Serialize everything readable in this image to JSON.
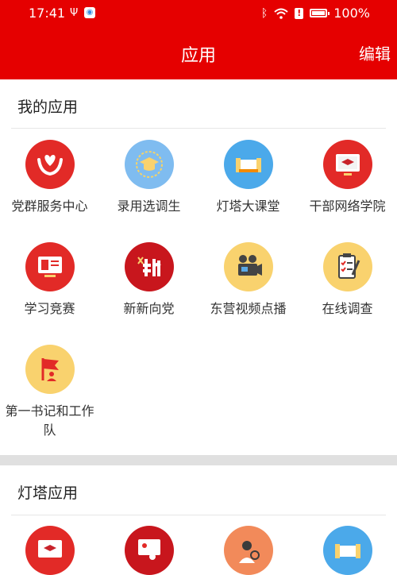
{
  "status_bar": {
    "time": "17:41",
    "battery": "100%"
  },
  "header": {
    "title": "应用",
    "edit_label": "编辑"
  },
  "sections": [
    {
      "title": "我的应用",
      "apps": [
        {
          "label": "党群服务中心",
          "icon": "heart-hands-icon",
          "color": "#e22a27"
        },
        {
          "label": "录用选调生",
          "icon": "graduation-cap-icon",
          "color": "#4ba9ea"
        },
        {
          "label": "灯塔大课堂",
          "icon": "classroom-board-icon",
          "color": "#4ba9ea"
        },
        {
          "label": "干部网络学院",
          "icon": "monitor-cap-icon",
          "color": "#e22a27"
        },
        {
          "label": "学习竞赛",
          "icon": "study-monitor-icon",
          "color": "#e22a27"
        },
        {
          "label": "新新向党",
          "icon": "xin-logo-icon",
          "color": "#e22a27"
        },
        {
          "label": "东营视频点播",
          "icon": "video-projector-icon",
          "color": "#f9d26e"
        },
        {
          "label": "在线调查",
          "icon": "clipboard-survey-icon",
          "color": "#f9d26e"
        },
        {
          "label": "第一书记和工作队",
          "icon": "red-flag-person-icon",
          "color": "#f9d26e"
        }
      ]
    },
    {
      "title": "灯塔应用",
      "apps": [
        {
          "label": "",
          "icon": "monitor-cap-icon",
          "color": "#e22a27"
        },
        {
          "label": "",
          "icon": "party-presenter-icon",
          "color": "#e22a27"
        },
        {
          "label": "",
          "icon": "person-search-icon",
          "color": "#f28a5a"
        },
        {
          "label": "",
          "icon": "classroom-board-icon",
          "color": "#4ba9ea"
        }
      ]
    }
  ]
}
